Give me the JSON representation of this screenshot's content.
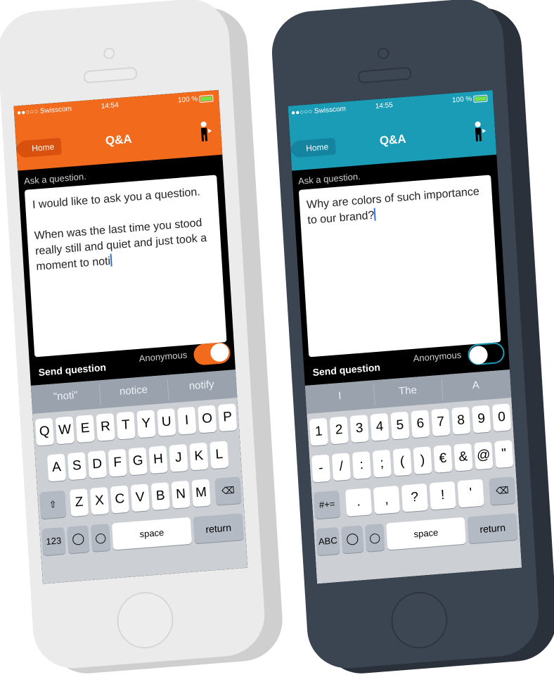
{
  "left_phone": {
    "status": {
      "carrier": "●●○○○ Swisscom",
      "time": "14:54",
      "battery": "100 %"
    },
    "nav": {
      "home_label": "Home",
      "title": "Q&A"
    },
    "prompt": "Ask a question.",
    "question_text": "I would like to ask you a question.\n\nWhen was the last time you stood really still and quiet and just took a moment to noti",
    "send_label": "Send question",
    "anonymous_label": "Anonymous",
    "anonymous_on": true,
    "suggestions": [
      "\"noti\"",
      "notice",
      "notify"
    ],
    "keys": {
      "row1": [
        "Q",
        "W",
        "E",
        "R",
        "T",
        "Y",
        "U",
        "I",
        "O",
        "P"
      ],
      "row2": [
        "A",
        "S",
        "D",
        "F",
        "G",
        "H",
        "J",
        "K",
        "L"
      ],
      "row3": [
        "Z",
        "X",
        "C",
        "V",
        "B",
        "N",
        "M"
      ],
      "numbers_label": "123",
      "space_label": "space",
      "return_label": "return"
    }
  },
  "right_phone": {
    "status": {
      "carrier": "●●○○○ Swisscom",
      "time": "14:55",
      "battery": "100 %"
    },
    "nav": {
      "home_label": "Home",
      "title": "Q&A"
    },
    "prompt": "Ask a question.",
    "question_text": "Why are colors of such importance to our brand?",
    "send_label": "Send question",
    "anonymous_label": "Anonymous",
    "anonymous_on": false,
    "suggestions": [
      "I",
      "The",
      "A"
    ],
    "keys": {
      "row1": [
        "1",
        "2",
        "3",
        "4",
        "5",
        "6",
        "7",
        "8",
        "9",
        "0"
      ],
      "row2": [
        "-",
        "/",
        ":",
        ";",
        "(",
        ")",
        "€",
        "&",
        "@",
        "\""
      ],
      "row3": [
        ".",
        ",",
        "?",
        "!",
        "'"
      ],
      "symbols_label": "#+=",
      "abc_label": "ABC",
      "space_label": "space",
      "return_label": "return"
    }
  },
  "colors": {
    "orange": "#f26a1b",
    "teal": "#1a9cb6",
    "white_phone": "#ebebeb",
    "dark_phone": "#3b4451"
  }
}
